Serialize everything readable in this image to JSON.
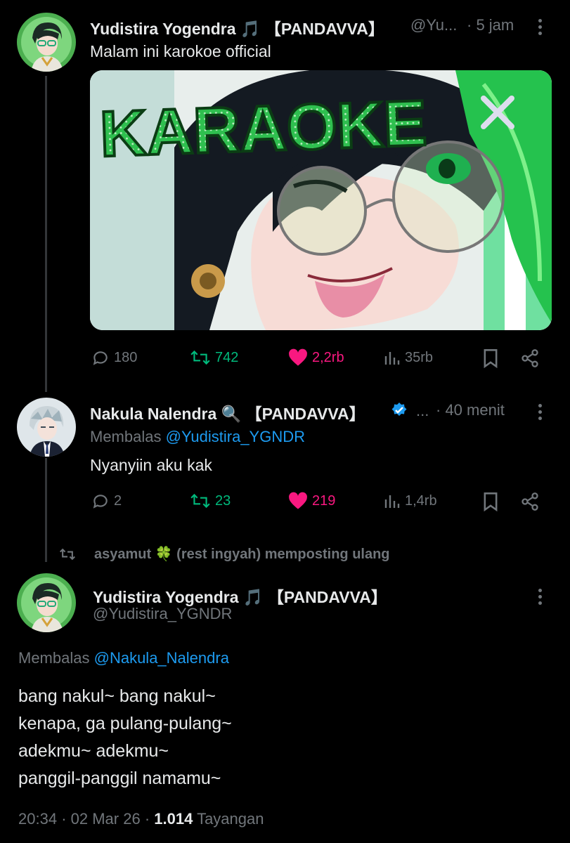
{
  "tweet1": {
    "author_name": "Yudistira Yogendra",
    "author_emoji": "🎵",
    "author_tag": "【PANDAVVA】",
    "handle": "@Yu...",
    "time": "· 5 jam",
    "text": "Malam ini karokoe official",
    "image_text": "KARAOKE",
    "replies": "180",
    "retweets": "742",
    "likes": "2,2rb",
    "views": "35rb"
  },
  "tweet2": {
    "author_name": "Nakula Nalendra",
    "author_emoji": "🔍",
    "author_tag": "【PANDAVVA】",
    "ellipsis": "...",
    "time": "· 40 menit",
    "replying_prefix": "Membalas",
    "replying_handle": "@Yudistira_YGNDR",
    "text": "Nyanyiin aku kak",
    "replies": "2",
    "retweets": "23",
    "likes": "219",
    "views": "1,4rb"
  },
  "repost_banner": "asyamut 🍀 (rest ingyah) memposting ulang",
  "tweet3": {
    "author_name": "Yudistira Yogendra",
    "author_emoji": "🎵",
    "author_tag": "【PANDAVVA】",
    "handle": "@Yudistira_YGNDR",
    "replying_prefix": "Membalas",
    "replying_handle": "@Nakula_Nalendra",
    "lines": [
      "bang nakul~ bang nakul~",
      "kenapa, ga pulang-pulang~",
      "adekmu~ adekmu~",
      "panggil-panggil namamu~"
    ],
    "time": "20:34",
    "date": "02 Mar 26",
    "views_count": "1.014",
    "views_label": "Tayangan"
  },
  "colors": {
    "background": "#000000",
    "text": "#e7e9ea",
    "muted": "#71767b",
    "link": "#1d9bf0",
    "retweet": "#00ba7c",
    "like": "#f91880",
    "karaoke_green": "#2fbf4f"
  },
  "icons": [
    "reply-icon",
    "retweet-icon",
    "like-icon",
    "views-icon",
    "bookmark-icon",
    "share-icon",
    "more-icon",
    "verified-icon"
  ]
}
